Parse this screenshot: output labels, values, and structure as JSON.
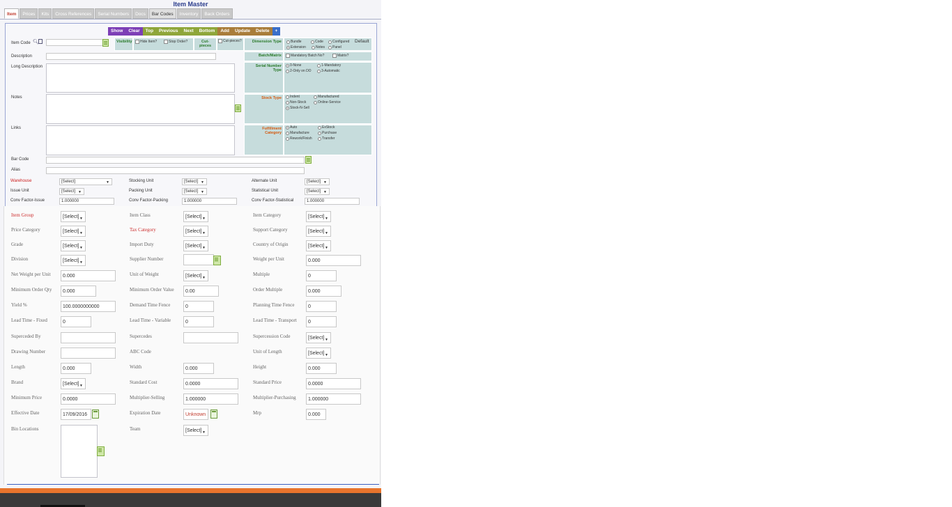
{
  "title": "Item Master",
  "tabs": [
    "Item",
    "Prices",
    "Kits",
    "Cross References",
    "Serial Numbers",
    "Docs",
    "Bar Codes",
    "Inventory",
    "Back Orders"
  ],
  "toolbar": {
    "show": "Show",
    "clear": "Clear",
    "top": "Top",
    "previous": "Previous",
    "next": "Next",
    "bottom": "Bottom",
    "add": "Add",
    "update": "Update",
    "delete": "Delete",
    "plus": "+"
  },
  "colors": {
    "purple": "#7d3fb6",
    "olive": "#8fa63a",
    "brown": "#a97d3a",
    "blue": "#3a6ec9",
    "panel": "#c6dcdc",
    "footer": "#e8742c"
  },
  "form": {
    "item_code": "Item Code",
    "description": "Description",
    "long_description": "Long Description",
    "notes": "Notes",
    "links": "Links",
    "bar_code": "Bar Code",
    "alias": "Alias"
  },
  "options": {
    "visibility": "Visibility",
    "hide_item": "Hide Item?",
    "stop_order": "Stop Order?",
    "cut_pieces": "Cut-pieces",
    "cut_pieces_q": "Cut-pieces?",
    "dimension_type": "Dimension Type",
    "bundle": "Bundle",
    "code": "Code",
    "configured": "Configured",
    "default": "Default",
    "extension": "Extension",
    "notes": "Notes",
    "panel": "Panel",
    "batch_matrix": "Batch/Matrix",
    "mandatory_batch": "Mandatory Batch No?",
    "matrix": "Matrix?",
    "serial_number_type": "Serial Number Type",
    "sn_none": "0-None",
    "sn_mandatory": "1-Mandatory",
    "sn_only_do": "2-Only on DO",
    "sn_automatic": "3-Automatic",
    "stock_type": "Stock Type",
    "indent": "Indent",
    "manufactured": "Manufactured",
    "non_stock": "Non-Stock",
    "online_service": "Online-Service",
    "stock_n_sell": "Stock-N-Sell",
    "fulfillment_category": "Fulfillment Category",
    "auto": "Auto",
    "exstock": "ExStock",
    "manufacture": "Manufacture",
    "purchase": "Purchase",
    "rework": "Rework/Finish",
    "transfer": "Transfer"
  },
  "units": {
    "warehouse": "Warehouse",
    "warehouse_val": "[Select]",
    "stocking_unit": "Stocking Unit",
    "stocking_val": "[Select]",
    "alternate_unit": "Alternate Unit",
    "alternate_val": "[Select]",
    "issue_unit": "Issue Unit",
    "issue_val": "[Select]",
    "packing_unit": "Packing Unit",
    "packing_val": "[Select]",
    "statistical_unit": "Statistical Unit",
    "statistical_val": "[Select]",
    "conv_issue": "Conv Factor-Issue",
    "conv_issue_val": "1.000000",
    "conv_packing": "Conv Factor-Packing",
    "conv_packing_val": "1.000000",
    "conv_statistical": "Conv Factor-Statistical",
    "conv_statistical_val": "1.000000"
  },
  "lower": {
    "item_group": "Item Group",
    "item_group_val": "[Select]",
    "item_class": "Item Class",
    "item_class_val": "[Select]",
    "item_category": "Item Category",
    "item_category_val": "[Select]",
    "price_category": "Price Category",
    "price_category_val": "[Select]",
    "tax_category": "Tax Category",
    "tax_category_val": "[Select]",
    "support_category": "Support Category",
    "support_category_val": "[Select]",
    "grade": "Grade",
    "grade_val": "[Select]",
    "import_duty": "Import Duty",
    "import_duty_val": "[Select]",
    "country_origin": "Country of Origin",
    "country_origin_val": "[Select]",
    "division": "Division",
    "division_val": "[Select]",
    "supplier_number": "Supplier Number",
    "weight_per_unit": "Weight per Unit",
    "weight_per_unit_val": "0.000",
    "net_weight": "Net Weight per Unit",
    "net_weight_val": "0.000",
    "unit_weight": "Unit of Weight",
    "unit_weight_val": "[Select]",
    "multiple": "Multiple",
    "multiple_val": "0",
    "min_order_qty": "Minimum Order Qty",
    "min_order_qty_val": "0.000",
    "min_order_value": "Minimum Order Value",
    "min_order_value_val": "0.00",
    "order_multiple": "Order Multiple",
    "order_multiple_val": "0.000",
    "yield": "Yield %",
    "yield_val": "100.0000000000",
    "demand_time_fence": "Demand Time Fence",
    "demand_time_fence_val": "0",
    "planning_time_fence": "Planning Time Fence",
    "planning_time_fence_val": "0",
    "lead_fixed": "Lead Time - Fixed",
    "lead_fixed_val": "0",
    "lead_variable": "Lead Time - Variable",
    "lead_variable_val": "0",
    "lead_transport": "Lead Time - Transport",
    "lead_transport_val": "0",
    "superceded_by": "Superceded By",
    "supercedes": "Supercedes",
    "supercession_code": "Supercession Code",
    "supercession_code_val": "[Select]",
    "drawing_number": "Drawing Number",
    "abc_code": "ABC Code",
    "unit_length": "Unit of Length",
    "unit_length_val": "[Select]",
    "length": "Length",
    "length_val": "0.000",
    "width": "Width",
    "width_val": "0.000",
    "height": "Height",
    "height_val": "0.000",
    "brand": "Brand",
    "brand_val": "[Select]",
    "standard_cost": "Standard Cost",
    "standard_cost_val": "0.0000",
    "standard_price": "Standard Price",
    "standard_price_val": "0.0000",
    "minimum_price": "Minimum Price",
    "minimum_price_val": "0.0000",
    "multiplier_selling": "Multiplier-Selling",
    "multiplier_selling_val": "1.000000",
    "multiplier_purchasing": "Multiplier-Purchasing",
    "multiplier_purchasing_val": "1.000000",
    "effective_date": "Effective Date",
    "effective_date_val": "17/09/2016",
    "expiration_date": "Expiration Date",
    "expiration_date_val": "Unknown",
    "mrp": "Mrp",
    "mrp_val": "0.000",
    "bin_locations": "Bin Locations",
    "team": "Team",
    "team_val": "[Select]"
  }
}
